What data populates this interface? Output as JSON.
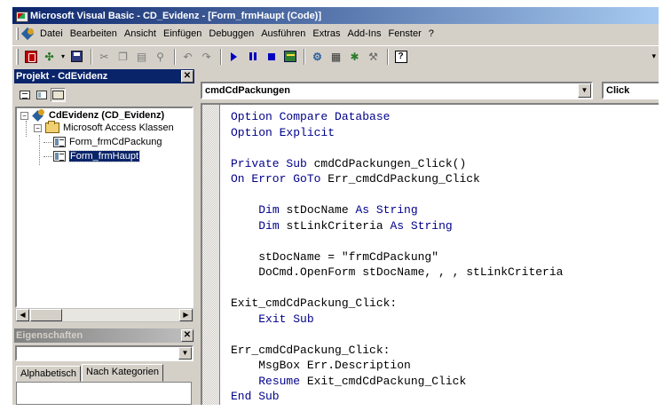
{
  "window": {
    "title": "Microsoft Visual Basic - CD_Evidenz - [Form_frmHaupt (Code)]"
  },
  "menu": {
    "items": [
      "Datei",
      "Bearbeiten",
      "Ansicht",
      "Einfügen",
      "Debuggen",
      "Ausführen",
      "Extras",
      "Add-Ins",
      "Fenster",
      "?"
    ]
  },
  "toolbar": {
    "buttons": [
      "view-access-icon",
      "insert-module-icon",
      "save-icon",
      "cut-icon",
      "copy-icon",
      "paste-icon",
      "find-icon",
      "undo-icon",
      "redo-icon",
      "run-icon",
      "break-icon",
      "reset-icon",
      "design-mode-icon",
      "project-explorer-icon",
      "properties-icon",
      "object-browser-icon",
      "toolbox-icon",
      "help-icon"
    ],
    "overflow_glyph": "▾"
  },
  "project_pane": {
    "title": "Projekt - CdEvidenz",
    "close_glyph": "✕",
    "tree": {
      "project": "CdEvidenz (CD_Evidenz)",
      "folder": "Microsoft Access Klassen",
      "items": [
        "Form_frmCdPackung",
        "Form_frmHaupt"
      ],
      "selected": "Form_frmHaupt",
      "collapse_glyph": "−"
    }
  },
  "properties_pane": {
    "title": "Eigenschaften",
    "close_glyph": "✕",
    "combo_value": "",
    "tabs": [
      "Alphabetisch",
      "Nach Kategorien"
    ],
    "active_tab": "Nach Kategorien"
  },
  "code_window": {
    "object_combo": "cmdCdPackungen",
    "procedure_combo": "Click",
    "dropdown_glyph": "▼",
    "lines": [
      [
        [
          "kw",
          "Option Compare Database"
        ]
      ],
      [
        [
          "kw",
          "Option Explicit"
        ]
      ],
      [
        [
          "",
          ""
        ]
      ],
      [
        [
          "kw",
          "Private Sub "
        ],
        [
          "",
          "cmdCdPackungen_Click()"
        ]
      ],
      [
        [
          "kw",
          "On Error GoTo "
        ],
        [
          "",
          "Err_cmdCdPackung_Click"
        ]
      ],
      [
        [
          "",
          ""
        ]
      ],
      [
        [
          "",
          "    "
        ],
        [
          "kw",
          "Dim "
        ],
        [
          "",
          "stDocName "
        ],
        [
          "kw",
          "As String"
        ]
      ],
      [
        [
          "",
          "    "
        ],
        [
          "kw",
          "Dim "
        ],
        [
          "",
          "stLinkCriteria "
        ],
        [
          "kw",
          "As String"
        ]
      ],
      [
        [
          "",
          ""
        ]
      ],
      [
        [
          "",
          "    stDocName = \"frmCdPackung\""
        ]
      ],
      [
        [
          "",
          "    DoCmd.OpenForm stDocName, , , stLinkCriteria"
        ]
      ],
      [
        [
          "",
          ""
        ]
      ],
      [
        [
          "",
          "Exit_cmdCdPackung_Click:"
        ]
      ],
      [
        [
          "",
          "    "
        ],
        [
          "kw",
          "Exit Sub"
        ]
      ],
      [
        [
          "",
          ""
        ]
      ],
      [
        [
          "",
          "Err_cmdCdPackung_Click:"
        ]
      ],
      [
        [
          "",
          "    MsgBox Err.Description"
        ]
      ],
      [
        [
          "",
          "    "
        ],
        [
          "kw",
          "Resume "
        ],
        [
          "",
          "Exit_cmdCdPackung_Click"
        ]
      ],
      [
        [
          "kw",
          "End Sub"
        ]
      ]
    ]
  },
  "colors": {
    "keyword": "#00008b",
    "titlebar": "#0a246a",
    "face": "#d4d0c8"
  }
}
